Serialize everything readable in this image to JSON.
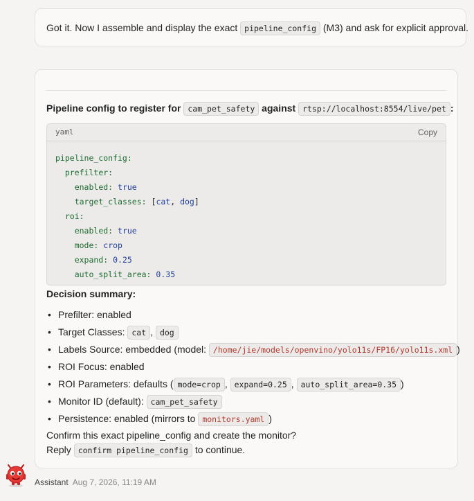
{
  "top_message": {
    "before": "Got it. Now I assemble and display the exact ",
    "code": "pipeline_config",
    "after": " (M3) and ask for explicit approval."
  },
  "heading": {
    "prefix": "Pipeline config to register for ",
    "monitor_id": "cam_pet_safety",
    "middle": " against ",
    "source": "rtsp://localhost:8554/live/pet",
    "suffix": ":"
  },
  "code_block": {
    "language": "yaml",
    "copy_label": "Copy",
    "lines": [
      {
        "indent": "",
        "key": "pipeline_config:",
        "value": ""
      },
      {
        "indent": "  ",
        "key": "prefilter:",
        "value": ""
      },
      {
        "indent": "    ",
        "key": "enabled:",
        "value": "true"
      },
      {
        "indent": "    ",
        "key": "target_classes:",
        "value": "[cat, dog]"
      },
      {
        "indent": "  ",
        "key": "roi:",
        "value": ""
      },
      {
        "indent": "    ",
        "key": "enabled:",
        "value": "true"
      },
      {
        "indent": "    ",
        "key": "mode:",
        "value": "crop"
      },
      {
        "indent": "    ",
        "key": "expand:",
        "value": "0.25"
      },
      {
        "indent": "    ",
        "key": "auto_split_area:",
        "value": "0.35"
      }
    ]
  },
  "summary": {
    "title": "Decision summary:",
    "prefilter": "Prefilter: enabled",
    "target_label": "Target Classes: ",
    "target_a": "cat",
    "target_b": "dog",
    "labels_label": "Labels Source: embedded (model: ",
    "labels_path": "/home/jie/models/openvino/yolo11s/FP16/yolo11s.xml",
    "labels_close": ")",
    "roi_focus": "ROI Focus: enabled",
    "roi_params_label": "ROI Parameters: defaults (",
    "roi_mode": "mode=crop",
    "roi_expand": "expand=0.25",
    "roi_split": "auto_split_area=0.35",
    "roi_close": ")",
    "monitor_label": "Monitor ID (default): ",
    "monitor_value": "cam_pet_safety",
    "persistence_label": "Persistence: enabled (mirrors to ",
    "persistence_file": "monitors.yaml",
    "persistence_close": ")"
  },
  "confirm_text": "Confirm this exact pipeline_config and create the monitor?",
  "reply": {
    "before": "Reply ",
    "code": "confirm pipeline_config",
    "after": " to continue."
  },
  "footer": {
    "sender": "Assistant",
    "timestamp": "Aug 7, 2026, 11:19 AM",
    "avatar_icon": "red-robot-avatar-icon"
  }
}
